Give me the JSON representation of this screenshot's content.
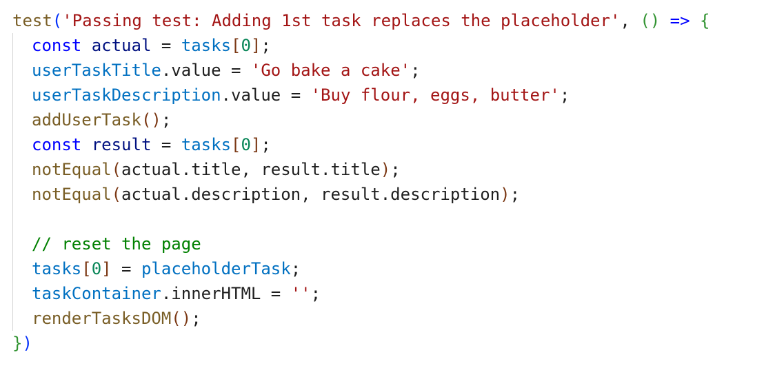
{
  "code": {
    "l1": {
      "fn": "test",
      "p1": "(",
      "str": "'Passing test: Adding 1st task replaces the placeholder'",
      "comma": ", ",
      "arrow_open": "()",
      "arrow": " => ",
      "brace": "{"
    },
    "l2": {
      "kw": "const",
      "sp": " ",
      "name": "actual",
      "eq": " = ",
      "obj": "tasks",
      "b1": "[",
      "num": "0",
      "b2": "]",
      "semi": ";"
    },
    "l3": {
      "obj": "userTaskTitle",
      "prop": ".value",
      "eq": " = ",
      "str": "'Go bake a cake'",
      "semi": ";"
    },
    "l4": {
      "obj": "userTaskDescription",
      "prop": ".value",
      "eq": " = ",
      "str": "'Buy flour, eggs, butter'",
      "semi": ";"
    },
    "l5": {
      "fn": "addUserTask",
      "parens": "()",
      "semi": ";"
    },
    "l6": {
      "kw": "const",
      "sp": " ",
      "name": "result",
      "eq": " = ",
      "obj": "tasks",
      "b1": "[",
      "num": "0",
      "b2": "]",
      "semi": ";"
    },
    "l7": {
      "fn": "notEqual",
      "p1": "(",
      "args": "actual.title, result.title",
      "p2": ")",
      "semi": ";"
    },
    "l8": {
      "fn": "notEqual",
      "p1": "(",
      "args": "actual.description, result.description",
      "p2": ")",
      "semi": ";"
    },
    "l10": {
      "comment": "// reset the page"
    },
    "l11": {
      "obj": "tasks",
      "b1": "[",
      "num": "0",
      "b2": "]",
      "eq": " = ",
      "val": "placeholderTask",
      "semi": ";"
    },
    "l12": {
      "obj": "taskContainer",
      "prop": ".innerHTML",
      "eq": " = ",
      "str": "''",
      "semi": ";"
    },
    "l13": {
      "fn": "renderTasksDOM",
      "parens": "()",
      "semi": ";"
    },
    "l14": {
      "brace": "}",
      "paren": ")"
    }
  }
}
